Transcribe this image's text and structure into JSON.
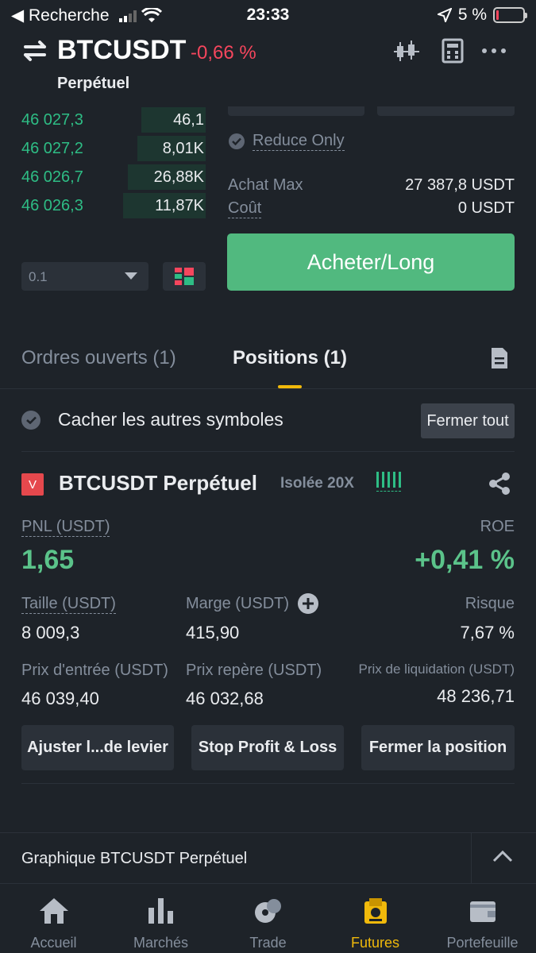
{
  "status_bar": {
    "back_label": "◀ Recherche",
    "time": "23:33",
    "battery": "5 %"
  },
  "header": {
    "symbol": "BTCUSDT",
    "change": "-0,66 %",
    "contract_type": "Perpétuel",
    "icons": [
      "swap-icon",
      "candlestick-chart-icon",
      "calculator-icon",
      "more-icon"
    ]
  },
  "orderbook": {
    "rows": [
      {
        "price": "46 027,3",
        "qty": "46,1",
        "depth": 0.35
      },
      {
        "price": "46 027,2",
        "qty": "8,01K",
        "depth": 0.37
      },
      {
        "price": "46 026,7",
        "qty": "26,88K",
        "depth": 0.42
      },
      {
        "price": "46 026,3",
        "qty": "11,87K",
        "depth": 0.45
      }
    ],
    "precision": "0.1"
  },
  "order_form": {
    "reduce_only": "Reduce Only",
    "achat_max_label": "Achat Max",
    "achat_max_value": "27 387,8 USDT",
    "cout_label": "Coût",
    "cout_value": "0 USDT",
    "buy_button": "Acheter/Long"
  },
  "tabs": {
    "open_orders": "Ordres ouverts (1)",
    "positions": "Positions (1)"
  },
  "positions": {
    "hide_others": "Cacher les autres symboles",
    "close_all": "Fermer tout",
    "item": {
      "side_badge": "V",
      "title": "BTCUSDT Perpétuel",
      "mode": "Isolée 20X",
      "pnl_label": "PNL (USDT)",
      "pnl_value": "1,65",
      "roe_label": "ROE",
      "roe_value": "+0,41 %",
      "size_label": "Taille (USDT)",
      "size_value": "8 009,3",
      "margin_label": "Marge (USDT)",
      "margin_value": "415,90",
      "risk_label": "Risque",
      "risk_value": "7,67 %",
      "entry_label": "Prix d'entrée (USDT)",
      "entry_value": "46 039,40",
      "mark_label": "Prix repère (USDT)",
      "mark_value": "46 032,68",
      "liq_label": "Prix de liquidation (USDT)",
      "liq_value": "48 236,71",
      "btn_leverage": "Ajuster l...de levier",
      "btn_tpsl": "Stop Profit & Loss",
      "btn_close": "Fermer la position"
    }
  },
  "chart_section": {
    "title": "Graphique BTCUSDT Perpétuel"
  },
  "bottom_nav": {
    "items": [
      {
        "label": "Accueil",
        "icon": "home-icon"
      },
      {
        "label": "Marchés",
        "icon": "markets-icon"
      },
      {
        "label": "Trade",
        "icon": "trade-icon"
      },
      {
        "label": "Futures",
        "icon": "futures-icon"
      },
      {
        "label": "Portefeuille",
        "icon": "wallet-icon"
      }
    ],
    "active": "Futures"
  },
  "colors": {
    "background": "#1e2329",
    "green": "#2ebd85",
    "red": "#f6465d",
    "yellow_accent": "#f0b90b",
    "buy_button": "#51b97f"
  }
}
